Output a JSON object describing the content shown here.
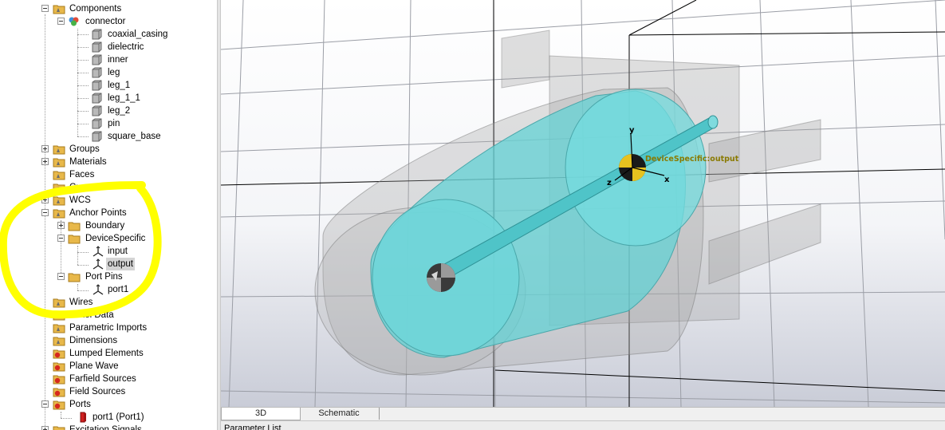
{
  "tree": {
    "components_label": "Components",
    "connector_label": "connector",
    "solids": [
      "coaxial_casing",
      "dielectric",
      "inner",
      "leg",
      "leg_1",
      "leg_1_1",
      "leg_2",
      "pin",
      "square_base"
    ],
    "groups": "Groups",
    "materials": "Materials",
    "faces": "Faces",
    "curves": "Curves",
    "wcs": "WCS",
    "anchor_points": "Anchor Points",
    "boundary": "Boundary",
    "device_specific": "DeviceSpecific",
    "input": "input",
    "output": "output",
    "port_pins": "Port Pins",
    "port1": "port1",
    "wires": "Wires",
    "voxel_data": "Voxel Data",
    "parametric_imports": "Parametric Imports",
    "dimensions": "Dimensions",
    "lumped_elements": "Lumped Elements",
    "plane_wave": "Plane Wave",
    "farfield_sources": "Farfield Sources",
    "field_sources": "Field Sources",
    "ports": "Ports",
    "port1_item": "port1 (Port1)",
    "excitation_signals": "Excitation Signals"
  },
  "viewport": {
    "anchor_label": "DeviceSpecific:output",
    "axis_x": "x",
    "axis_y": "y",
    "axis_z": "z",
    "cylinder_color": "#63d1d4",
    "label_color": "#8a7a00"
  },
  "tabs": {
    "tab_3d": "3D",
    "tab_schematic": "Schematic"
  },
  "bottom_panel": {
    "title": "Parameter List"
  },
  "highlight_color": "#ffff00"
}
